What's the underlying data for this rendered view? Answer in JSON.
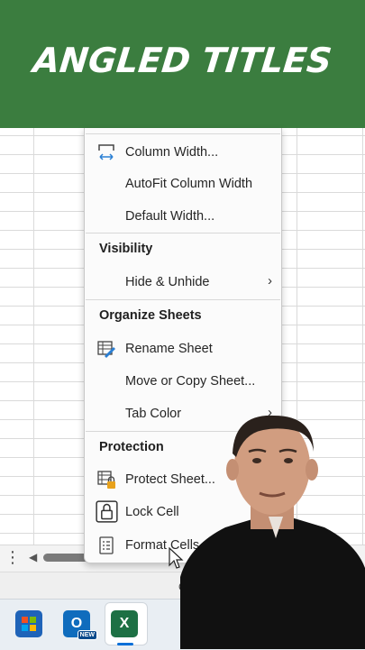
{
  "banner": {
    "title": "ANGLED TITLES"
  },
  "menu": {
    "items_top": [
      {
        "label": "Column Width...",
        "icon": "column-width-icon"
      },
      {
        "label": "AutoFit Column Width"
      },
      {
        "label": "Default Width..."
      }
    ],
    "visibility": {
      "heading": "Visibility",
      "hide_unhide": "Hide & Unhide"
    },
    "organize": {
      "heading": "Organize Sheets",
      "rename": "Rename Sheet",
      "move_copy": "Move or Copy Sheet...",
      "tab_color": "Tab Color"
    },
    "protection": {
      "heading": "Protection",
      "protect_sheet": "Protect Sheet...",
      "lock_cell": "Lock Cell",
      "format_cells": "Format Cells..."
    }
  },
  "statusbar": {
    "text": "Co"
  },
  "taskbar": {
    "store_icon": "microsoft-store-icon",
    "outlook_letter": "O",
    "outlook_badge": "NEW",
    "excel_letter": "X"
  },
  "colors": {
    "banner": "#3b7d3f",
    "excel": "#1d7044",
    "accent": "#0a6fd8"
  }
}
